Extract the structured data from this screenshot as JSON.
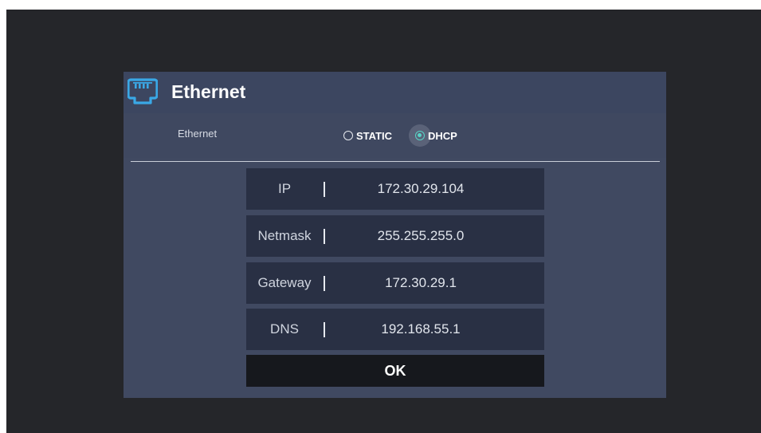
{
  "dialog": {
    "title": "Ethernet",
    "icon": "ethernet-port-icon"
  },
  "mode": {
    "label": "Ethernet",
    "options": [
      "STATIC",
      "DHCP"
    ],
    "selected": "DHCP",
    "accent_color": "#59d3c6"
  },
  "fields": [
    {
      "label": "IP",
      "value": "172.30.29.104"
    },
    {
      "label": "Netmask",
      "value": "255.255.255.0"
    },
    {
      "label": "Gateway",
      "value": "172.30.29.1"
    },
    {
      "label": "DNS",
      "value": "192.168.55.1"
    }
  ],
  "ok_label": "OK"
}
